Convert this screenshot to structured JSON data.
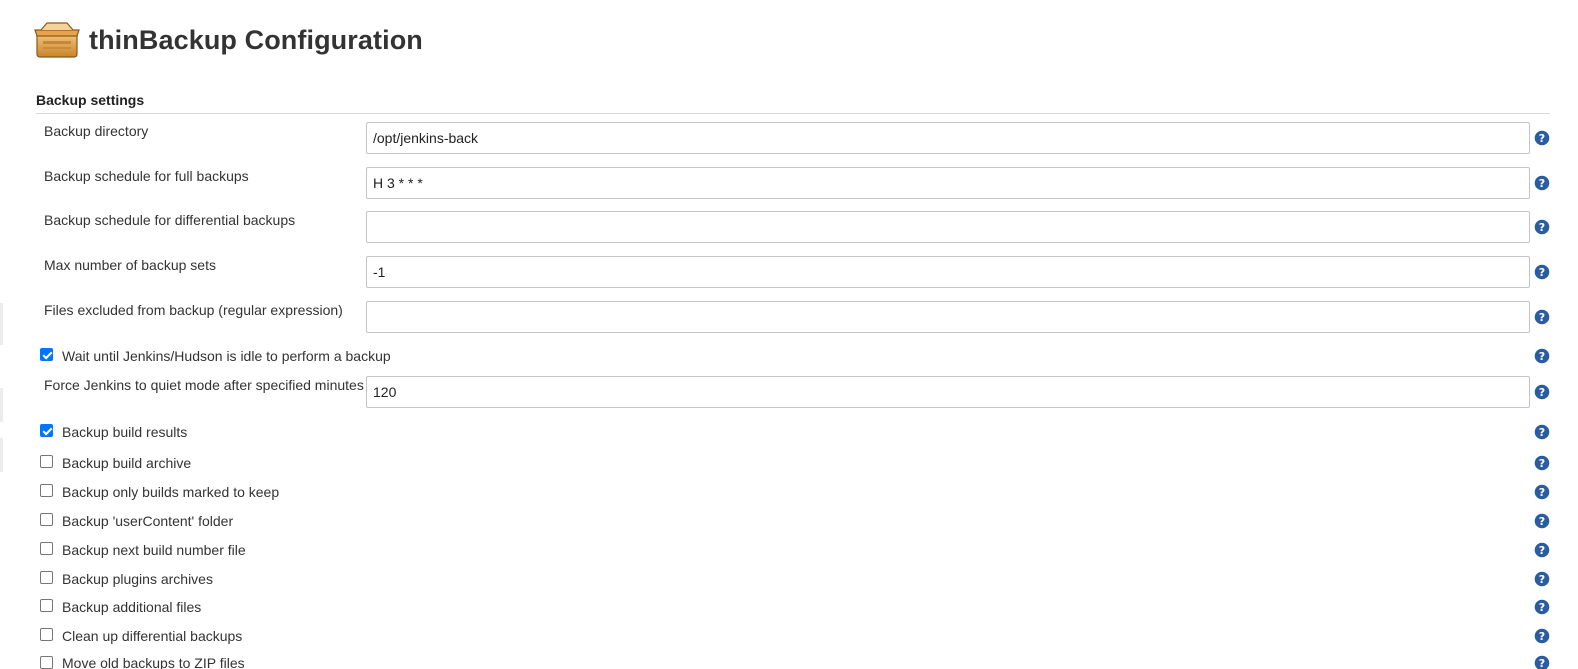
{
  "page": {
    "title": "thinBackup Configuration",
    "icon": "box-icon"
  },
  "section": {
    "title": "Backup settings"
  },
  "fields": [
    {
      "label": "Backup directory",
      "value": "/opt/jenkins-back"
    },
    {
      "label": "Backup schedule for full backups",
      "value": "H 3 * * *"
    },
    {
      "label": "Backup schedule for differential backups",
      "value": ""
    },
    {
      "label": "Max number of backup sets",
      "value": "-1"
    },
    {
      "label": "Files excluded from backup (regular expression)",
      "value": ""
    }
  ],
  "wait_idle": {
    "label": "Wait until Jenkins/Hudson is idle to perform a backup",
    "checked": true
  },
  "quiet_mode": {
    "label": "Force Jenkins to quiet mode after specified minutes",
    "value": "120"
  },
  "checkboxes": [
    {
      "label": "Backup build results",
      "checked": true
    },
    {
      "label": "Backup build archive",
      "checked": false
    },
    {
      "label": "Backup only builds marked to keep",
      "checked": false
    },
    {
      "label": "Backup 'userContent' folder",
      "checked": false
    },
    {
      "label": "Backup next build number file",
      "checked": false
    },
    {
      "label": "Backup plugins archives",
      "checked": false
    },
    {
      "label": "Backup additional files",
      "checked": false
    },
    {
      "label": "Clean up differential backups",
      "checked": false
    },
    {
      "label": "Move old backups to ZIP files",
      "checked": false
    }
  ],
  "colors": {
    "help_icon": "#2a5d9f",
    "checkbox_checked": "#0075ff",
    "box_icon": "#c8852a"
  }
}
